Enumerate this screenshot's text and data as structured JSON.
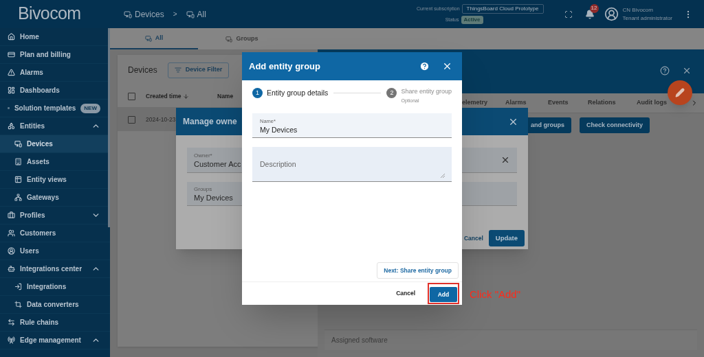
{
  "header": {
    "logo": "Bivocom",
    "breadcrumb": [
      {
        "label": "Devices"
      },
      {
        "label": "All"
      }
    ],
    "separator": ">",
    "subscription_label": "Current subscription",
    "subscription": "ThingsBoard Cloud Prototype",
    "status_label": "Status",
    "status": "Active",
    "notifications": "12",
    "user_name": "CN Bivocom",
    "user_role": "Tenant administrator"
  },
  "sidebar": {
    "items": [
      {
        "label": "Home",
        "selected": false
      },
      {
        "label": "Plan and billing",
        "selected": false
      },
      {
        "label": "Alarms",
        "selected": false
      },
      {
        "label": "Dashboards",
        "selected": false
      },
      {
        "label": "Solution templates",
        "badge": "NEW",
        "selected": false
      },
      {
        "label": "Entities",
        "selected": false,
        "expanded": true,
        "children": [
          {
            "label": "Devices",
            "selected": true
          },
          {
            "label": "Assets",
            "selected": false
          },
          {
            "label": "Entity views",
            "selected": false
          },
          {
            "label": "Gateways",
            "selected": false
          }
        ]
      },
      {
        "label": "Profiles",
        "selected": false,
        "expanded": false
      },
      {
        "label": "Customers",
        "selected": false
      },
      {
        "label": "Users",
        "selected": false
      },
      {
        "label": "Integrations center",
        "selected": false,
        "expanded": true,
        "children": [
          {
            "label": "Integrations",
            "selected": false
          },
          {
            "label": "Data converters",
            "selected": false
          }
        ]
      },
      {
        "label": "Rule chains",
        "selected": false
      },
      {
        "label": "Edge management",
        "selected": false,
        "expanded": true
      }
    ]
  },
  "tabs": [
    {
      "label": "All",
      "selected": true
    },
    {
      "label": "Groups",
      "selected": false
    }
  ],
  "devices": {
    "title": "Devices",
    "filter_button": "Device Filter",
    "select_all_checked": false,
    "columns": [
      "Created time",
      "Name"
    ],
    "rows": [
      {
        "created_time": "2024-10-23",
        "selected": true,
        "checked": false
      }
    ]
  },
  "detail_panel": {
    "tabs": [
      {
        "label": "elemetry",
        "selected": false
      },
      {
        "label": "Alarms",
        "selected": false
      },
      {
        "label": "Events",
        "selected": false
      },
      {
        "label": "Relations",
        "selected": false
      },
      {
        "label": "Audit logs",
        "selected": false
      }
    ],
    "buttons": [
      "and groups",
      "Check connectivity"
    ],
    "field_label": "Assigned software"
  },
  "manage_owner_dialog": {
    "title": "Manage owne",
    "owner_label": "Owner*",
    "owner_value": "Customer Acc",
    "groups_label": "Groups",
    "groups_value": "My Devices",
    "cancel": "Cancel",
    "update": "Update"
  },
  "add_group_dialog": {
    "title": "Add entity group",
    "steps": [
      {
        "number": "1",
        "label": "Entity group details",
        "selected": true
      },
      {
        "number": "2",
        "label": "Share entity group",
        "note": "Optional",
        "selected": false
      }
    ],
    "name_label": "Name*",
    "name_value": "My Devices",
    "description_placeholder": "Description",
    "next_button": "Next: Share entity group",
    "cancel": "Cancel",
    "add": "Add"
  },
  "annotation": "Click \"Add\""
}
